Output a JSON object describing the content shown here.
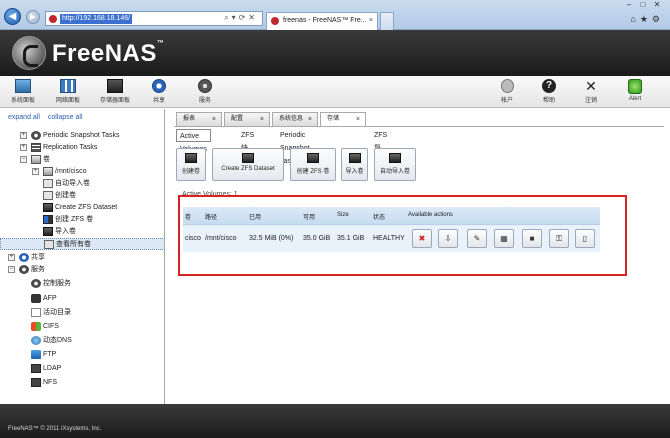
{
  "browser": {
    "url": "http://192.168.18.146/",
    "tab_active": "freenas - FreeNAS™ Fre...",
    "close_glyph": "×"
  },
  "app": {
    "logo_text": "FreeNAS",
    "logo_mark": "™"
  },
  "toolbar": {
    "system": "系统面板",
    "network": "网络面板",
    "storage": "存储器面板",
    "sharing": "共享",
    "services": "服务",
    "account": "帐户",
    "help": "帮助",
    "logout": "注销",
    "alert": "Alert"
  },
  "left": {
    "expand_all": "expand all",
    "collapse_all": "collapse all",
    "tree": [
      {
        "label": "Periodic Snapshot Tasks",
        "toggle": "+"
      },
      {
        "label": "Replication Tasks",
        "toggle": "+"
      },
      {
        "label": "卷",
        "toggle": "−"
      },
      {
        "label": "/mnt/cisco",
        "toggle": "+"
      },
      {
        "label": "自动导入卷"
      },
      {
        "label": "创建卷"
      },
      {
        "label": "Create ZFS Dataset"
      },
      {
        "label": "创建 ZFS 卷"
      },
      {
        "label": "导入卷"
      },
      {
        "label": "查看所有卷"
      },
      {
        "label": "共享",
        "toggle": "+"
      },
      {
        "label": "服务",
        "toggle": "−"
      },
      {
        "label": "控制服务"
      },
      {
        "label": "AFP"
      },
      {
        "label": "活动目录"
      },
      {
        "label": "CIFS"
      },
      {
        "label": "动态DNS"
      },
      {
        "label": "FTP"
      },
      {
        "label": "LDAP"
      },
      {
        "label": "NFS"
      }
    ]
  },
  "main": {
    "tabs": [
      {
        "label": "报表"
      },
      {
        "label": "配置"
      },
      {
        "label": "系统信息"
      },
      {
        "label": "存储"
      }
    ],
    "subtabs": [
      "Active Volumes",
      "ZFS 快照",
      "Periodic Snapshot Tasks",
      "ZFS 复制"
    ],
    "actions": [
      "创建卷",
      "Create ZFS Dataset",
      "创建 ZFS 卷",
      "导入卷",
      "自动导入卷"
    ],
    "volumes_count": "Active Volumes: 1",
    "table": {
      "headers": [
        "卷",
        "路径",
        "已用",
        "可用",
        "Size",
        "状态",
        "Available actions"
      ],
      "rows": [
        {
          "name": "cisco",
          "path": "/mnt/cisco",
          "used": "32.5 MiB (0%)",
          "avail": "35.0 GiB",
          "size": "35.1 GiB",
          "status": "HEALTHY"
        }
      ]
    }
  },
  "footer": {
    "copyright": "FreeNAS™ © 2011 iXsystems, Inc."
  }
}
